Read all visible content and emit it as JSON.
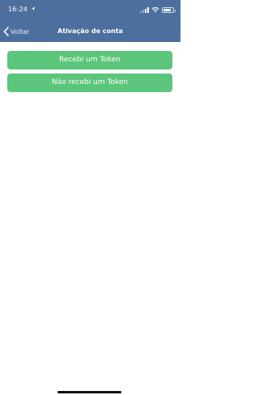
{
  "status_bar": {
    "time": "16:24",
    "icons": [
      "location-icon",
      "signal-icon",
      "wifi-icon",
      "battery-icon"
    ]
  },
  "nav": {
    "back_label": "Voltar",
    "title": "Ativação de conta"
  },
  "actions": {
    "received_token_label": "Recebi um Token",
    "not_received_token_label": "Não recebi um Token"
  },
  "colors": {
    "header": "#4d6f9e",
    "button": "#5cc57c",
    "background": "#ffffff"
  }
}
